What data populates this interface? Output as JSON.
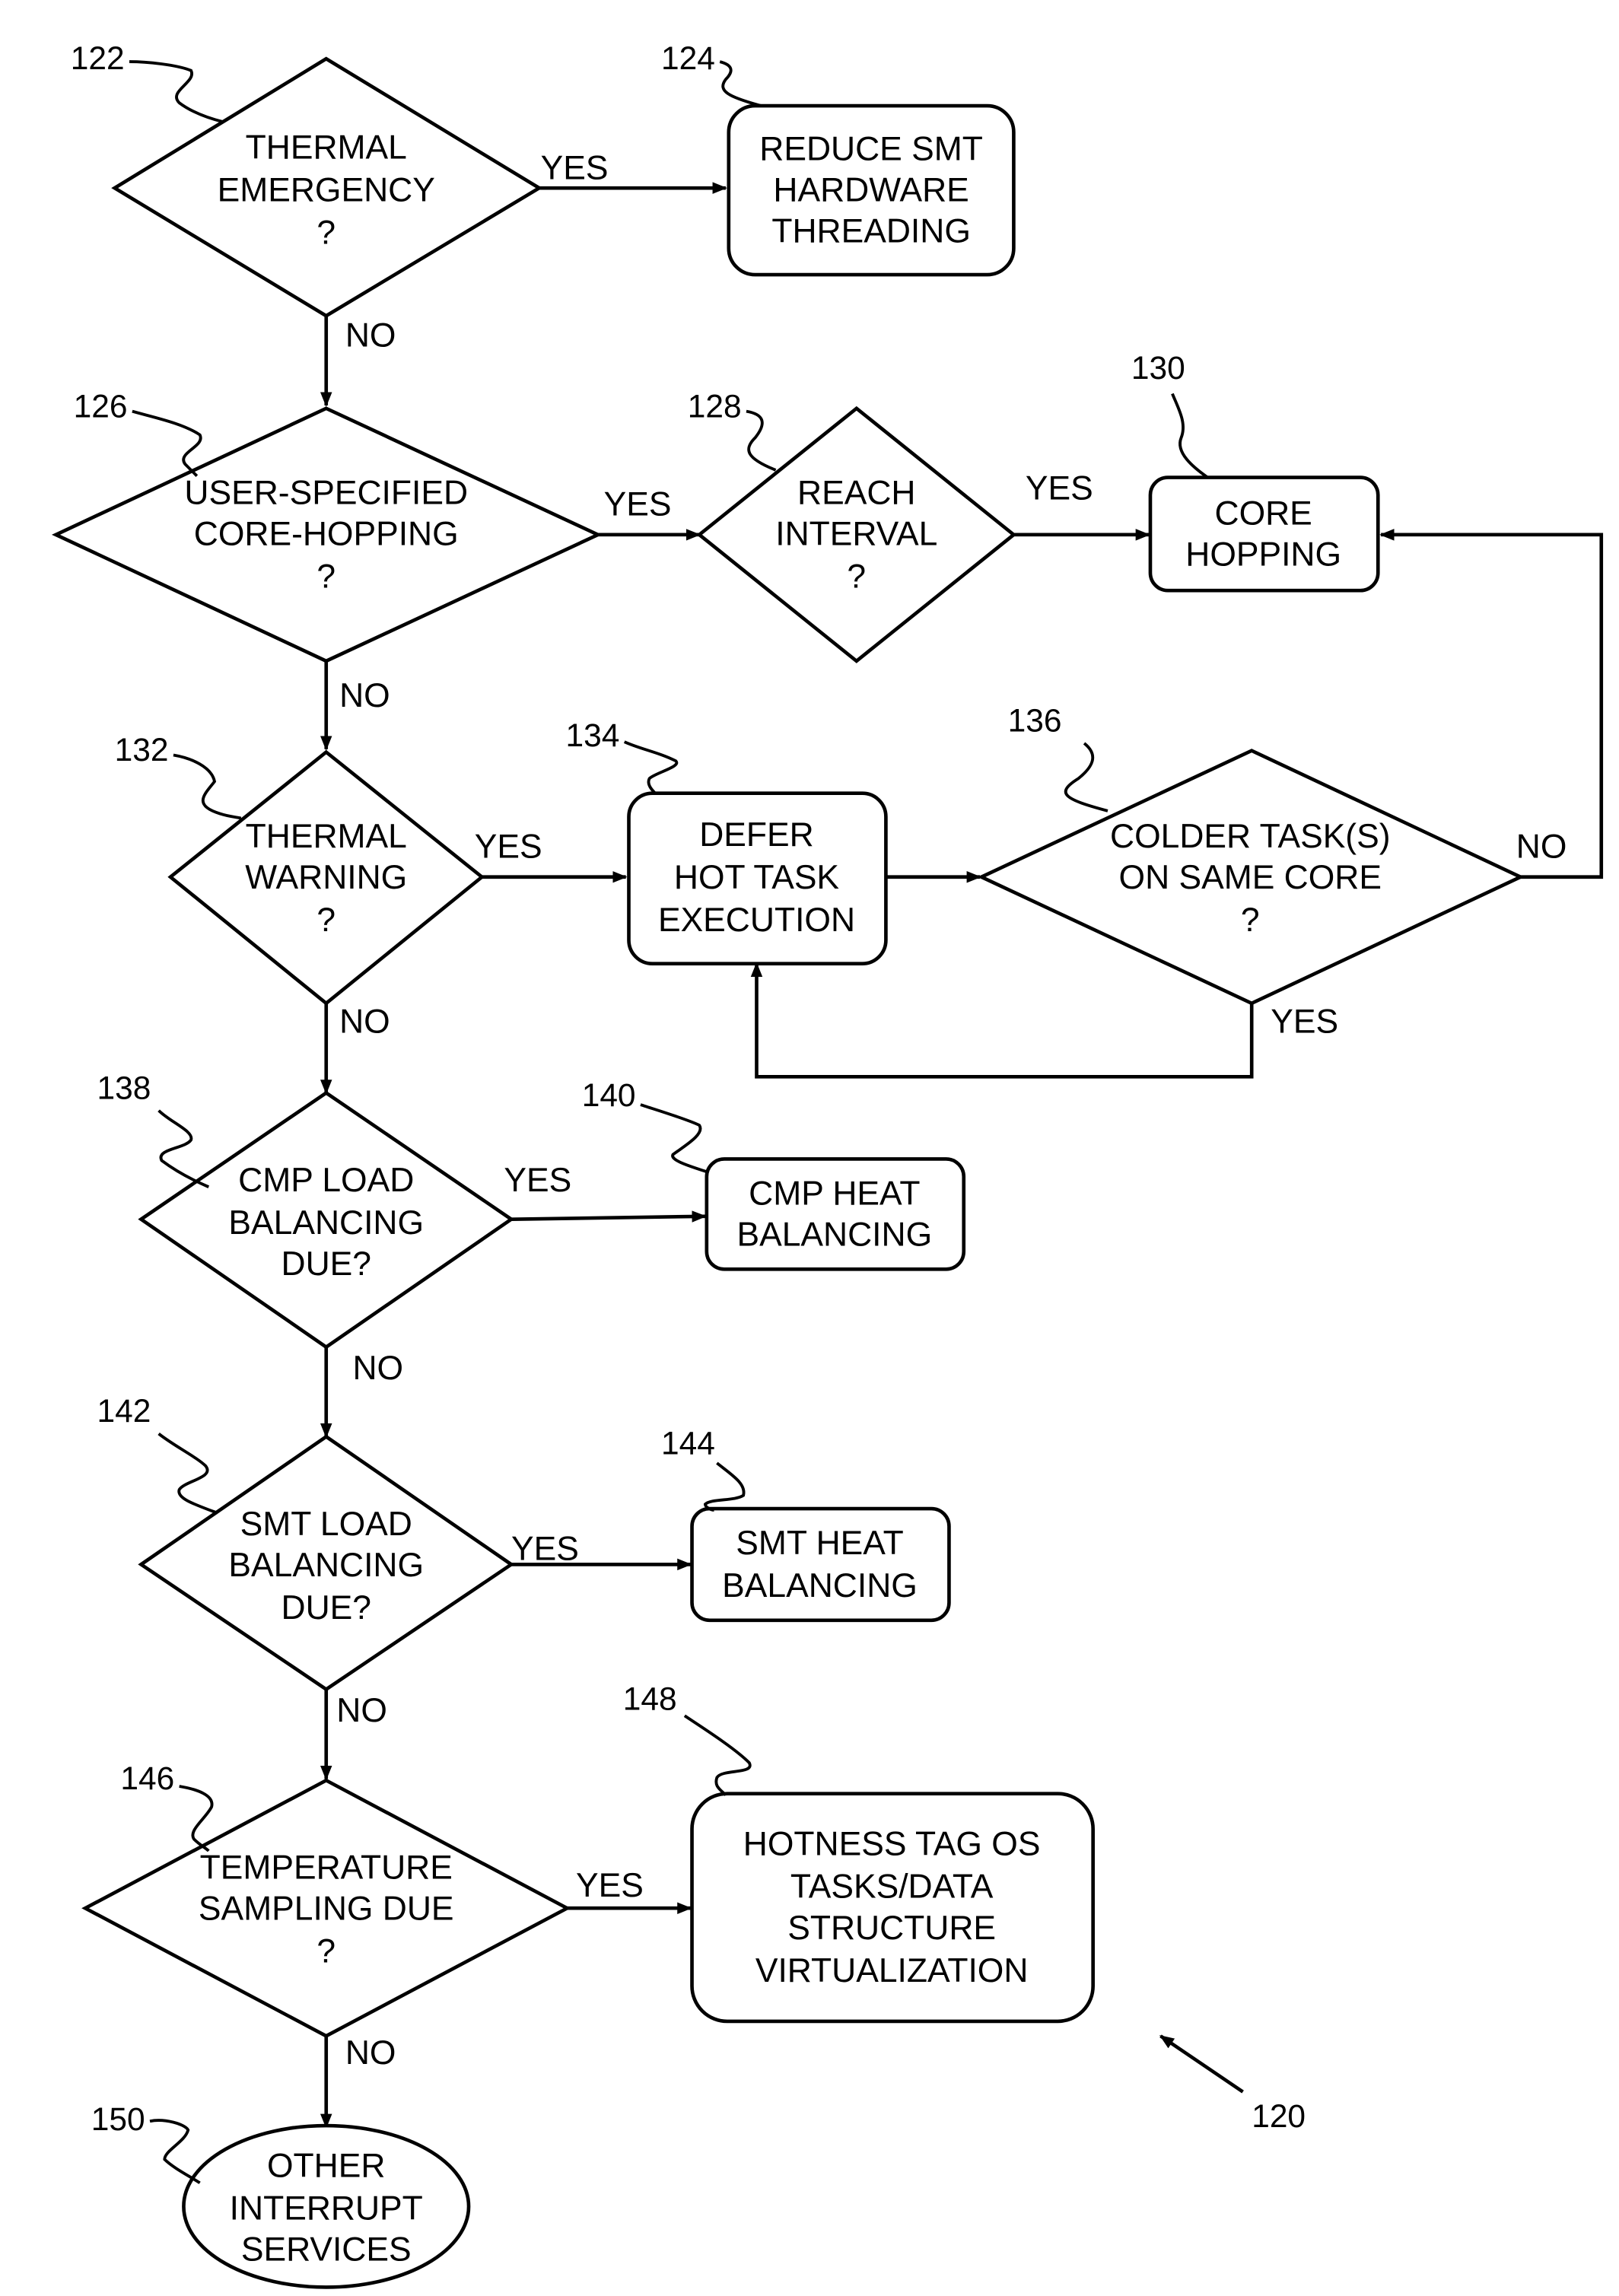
{
  "figure_ref": "120",
  "nodes": {
    "n122": {
      "ref": "122",
      "type": "decision",
      "lines": [
        "THERMAL",
        "EMERGENCY",
        "?"
      ]
    },
    "n124": {
      "ref": "124",
      "type": "process",
      "lines": [
        "REDUCE SMT",
        "HARDWARE",
        "THREADING"
      ]
    },
    "n126": {
      "ref": "126",
      "type": "decision",
      "lines": [
        "USER-SPECIFIED",
        "CORE-HOPPING",
        "?"
      ]
    },
    "n128": {
      "ref": "128",
      "type": "decision",
      "lines": [
        "REACH",
        "INTERVAL",
        "?"
      ]
    },
    "n130": {
      "ref": "130",
      "type": "process",
      "lines": [
        "CORE",
        "HOPPING"
      ]
    },
    "n132": {
      "ref": "132",
      "type": "decision",
      "lines": [
        "THERMAL",
        "WARNING",
        "?"
      ]
    },
    "n134": {
      "ref": "134",
      "type": "process",
      "lines": [
        "DEFER",
        "HOT TASK",
        "EXECUTION"
      ]
    },
    "n136": {
      "ref": "136",
      "type": "decision",
      "lines": [
        "COLDER TASK(S)",
        "ON SAME CORE",
        "?"
      ]
    },
    "n138": {
      "ref": "138",
      "type": "decision",
      "lines": [
        "CMP LOAD",
        "BALANCING",
        "DUE?"
      ]
    },
    "n140": {
      "ref": "140",
      "type": "process",
      "lines": [
        "CMP HEAT",
        "BALANCING"
      ]
    },
    "n142": {
      "ref": "142",
      "type": "decision",
      "lines": [
        "SMT LOAD",
        "BALANCING",
        "DUE?"
      ]
    },
    "n144": {
      "ref": "144",
      "type": "process",
      "lines": [
        "SMT HEAT",
        "BALANCING"
      ]
    },
    "n146": {
      "ref": "146",
      "type": "decision",
      "lines": [
        "TEMPERATURE",
        "SAMPLING DUE",
        "?"
      ]
    },
    "n148": {
      "ref": "148",
      "type": "process",
      "lines": [
        "HOTNESS TAG OS",
        "TASKS/DATA",
        "STRUCTURE",
        "VIRTUALIZATION"
      ]
    },
    "n150": {
      "ref": "150",
      "type": "terminal",
      "lines": [
        "OTHER",
        "INTERRUPT",
        "SERVICES"
      ]
    }
  },
  "edges": [
    {
      "from": "122",
      "to": "124",
      "label": "YES"
    },
    {
      "from": "122",
      "to": "126",
      "label": "NO"
    },
    {
      "from": "126",
      "to": "128",
      "label": "YES"
    },
    {
      "from": "128",
      "to": "130",
      "label": "YES"
    },
    {
      "from": "126",
      "to": "132",
      "label": "NO"
    },
    {
      "from": "132",
      "to": "134",
      "label": "YES"
    },
    {
      "from": "134",
      "to": "136",
      "label": ""
    },
    {
      "from": "136",
      "to": "130",
      "label": "NO"
    },
    {
      "from": "136",
      "to": "134",
      "label": "YES"
    },
    {
      "from": "132",
      "to": "138",
      "label": "NO"
    },
    {
      "from": "138",
      "to": "140",
      "label": "YES"
    },
    {
      "from": "138",
      "to": "142",
      "label": "NO"
    },
    {
      "from": "142",
      "to": "144",
      "label": "YES"
    },
    {
      "from": "142",
      "to": "146",
      "label": "NO"
    },
    {
      "from": "146",
      "to": "148",
      "label": "YES"
    },
    {
      "from": "146",
      "to": "150",
      "label": "NO"
    }
  ],
  "edge_labels": {
    "yes": "YES",
    "no": "NO"
  }
}
